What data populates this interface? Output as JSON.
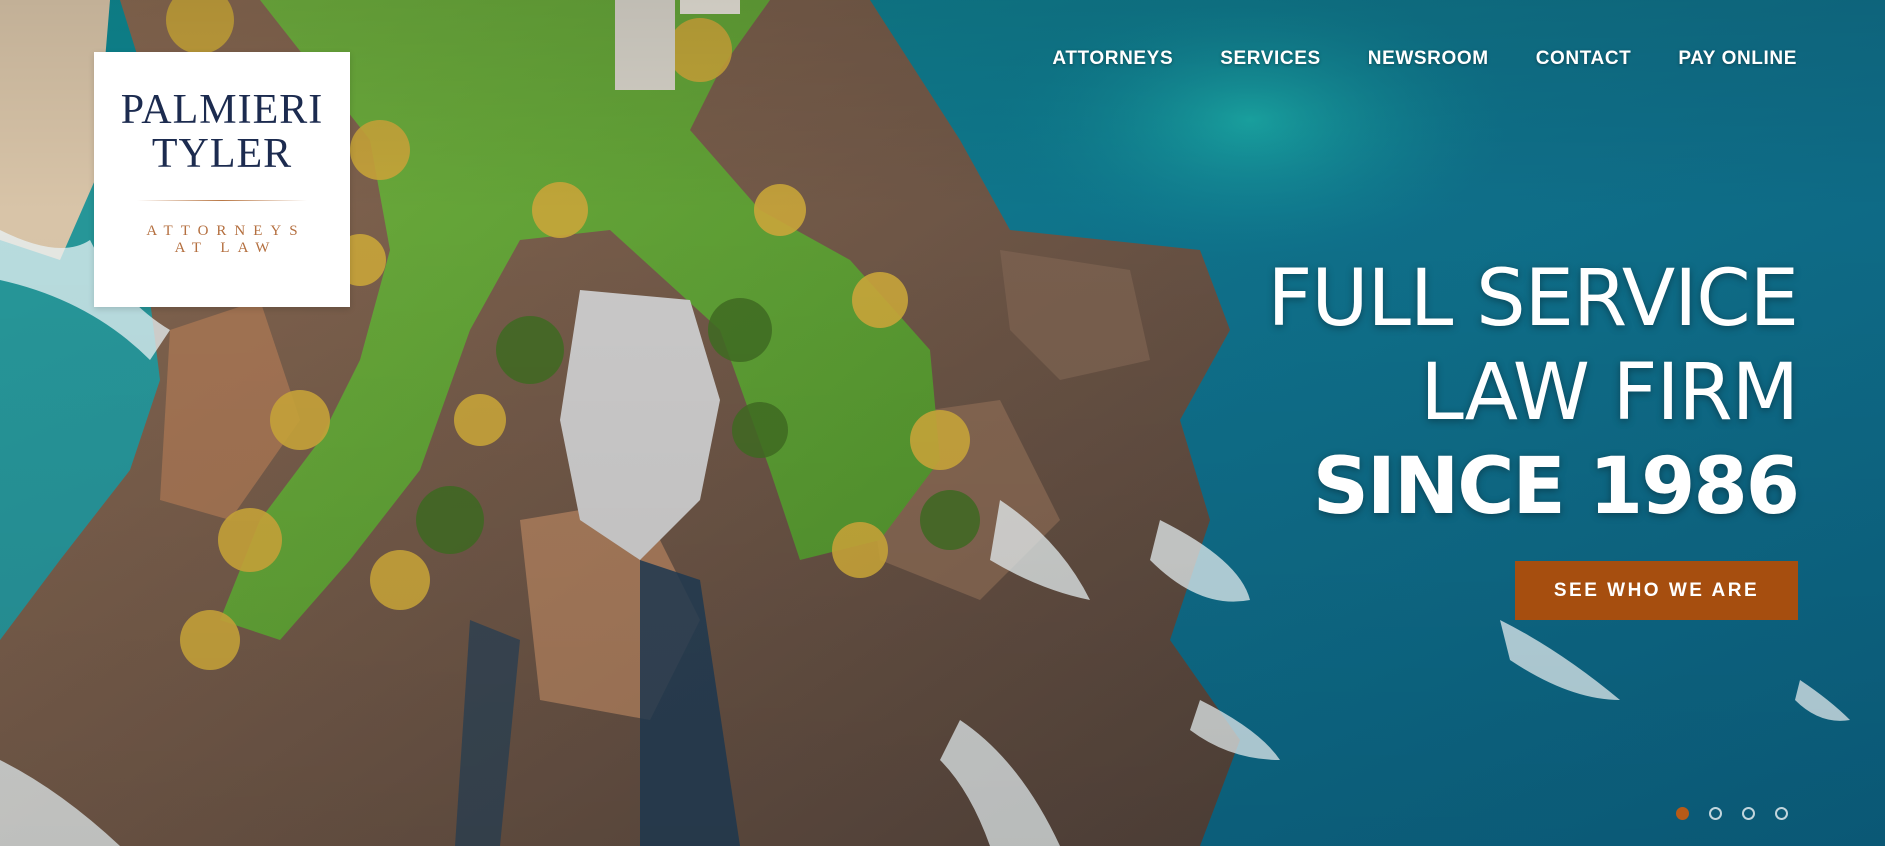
{
  "logo": {
    "line1": "PALMIERI",
    "line2": "TYLER",
    "tagline1": "ATTORNEYS",
    "tagline2": "AT LAW"
  },
  "nav": {
    "items": [
      {
        "label": "ATTORNEYS"
      },
      {
        "label": "SERVICES"
      },
      {
        "label": "NEWSROOM"
      },
      {
        "label": "CONTACT"
      },
      {
        "label": "PAY ONLINE"
      }
    ]
  },
  "hero": {
    "line1": "FULL SERVICE",
    "line2": "LAW FIRM",
    "line3": "SINCE 1986",
    "cta_label": "SEE WHO WE ARE"
  },
  "slider": {
    "count": 4,
    "active_index": 0
  },
  "colors": {
    "accent": "#a64e0f",
    "logo_navy": "#1c2b4f",
    "logo_copper": "#b46f3f",
    "ocean": "#0f6a86"
  }
}
